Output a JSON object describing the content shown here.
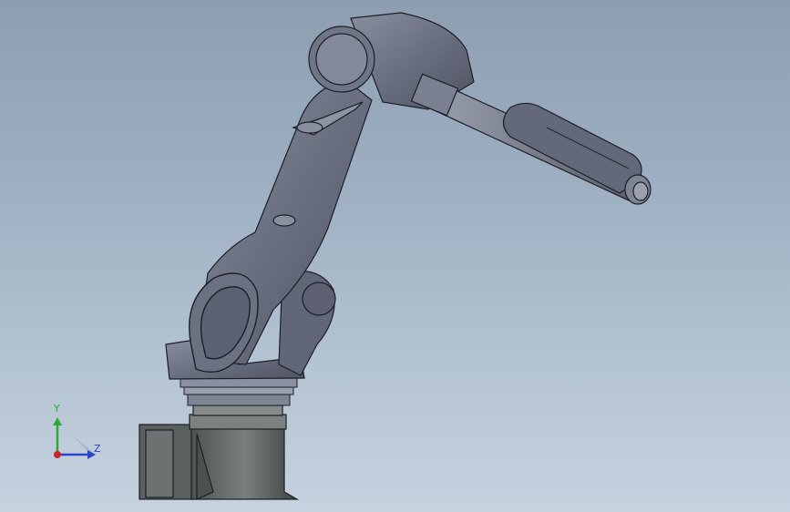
{
  "viewport": {
    "background_top": "#8e9eb1",
    "background_bottom": "#c6d2de",
    "model_color": "#6d7282",
    "edge_color": "#1c1f27"
  },
  "triad": {
    "y_label": "Y",
    "z_label": "Z",
    "y_color": "#2faa3a",
    "z_color": "#2a45c8",
    "x_color": "#c8262a"
  }
}
